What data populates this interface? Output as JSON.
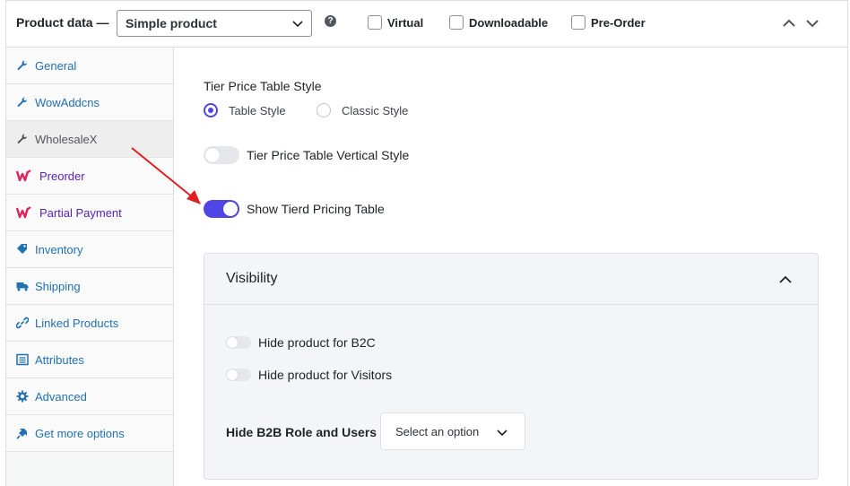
{
  "header": {
    "title": "Product data —",
    "product_type": "Simple product",
    "help_glyph": "?",
    "checkboxes": [
      {
        "label": "Virtual",
        "checked": false
      },
      {
        "label": "Downloadable",
        "checked": false
      },
      {
        "label": "Pre-Order",
        "checked": false
      }
    ]
  },
  "sidebar": {
    "items": [
      {
        "label": "General",
        "icon": "wrench-icon"
      },
      {
        "label": "WowAddcns",
        "icon": "wrench-icon"
      },
      {
        "label": "WholesaleX",
        "icon": "wrench-icon",
        "active": true
      },
      {
        "label": "Preorder",
        "icon": "wowstore-logo-icon"
      },
      {
        "label": "Partial Payment",
        "icon": "wowstore-logo-icon"
      },
      {
        "label": "Inventory",
        "icon": "tag-icon"
      },
      {
        "label": "Shipping",
        "icon": "truck-icon"
      },
      {
        "label": "Linked Products",
        "icon": "link-icon"
      },
      {
        "label": "Attributes",
        "icon": "list-icon"
      },
      {
        "label": "Advanced",
        "icon": "gear-icon"
      },
      {
        "label": "Get more options",
        "icon": "plugin-icon"
      }
    ]
  },
  "main": {
    "tier_label": "Tier Price Table Style",
    "radio_table": "Table Style",
    "radio_classic": "Classic Style",
    "selected_style": "Table Style",
    "vertical_toggle_label": "Tier Price Table Vertical Style",
    "vertical_toggle_on": false,
    "show_toggle_label": "Show Tierd Pricing Table",
    "show_toggle_on": true,
    "visibility": {
      "title": "Visibility",
      "hide_b2c": "Hide product for B2C",
      "hide_visitors": "Hide product for Visitors",
      "b2b_label": "Hide B2B Role and Users",
      "select_placeholder": "Select an option"
    }
  },
  "colors": {
    "accent": "#4f46e5",
    "link": "#2271b1",
    "brand_logo": "#e0245e",
    "annotation_arrow": "#e02020"
  }
}
